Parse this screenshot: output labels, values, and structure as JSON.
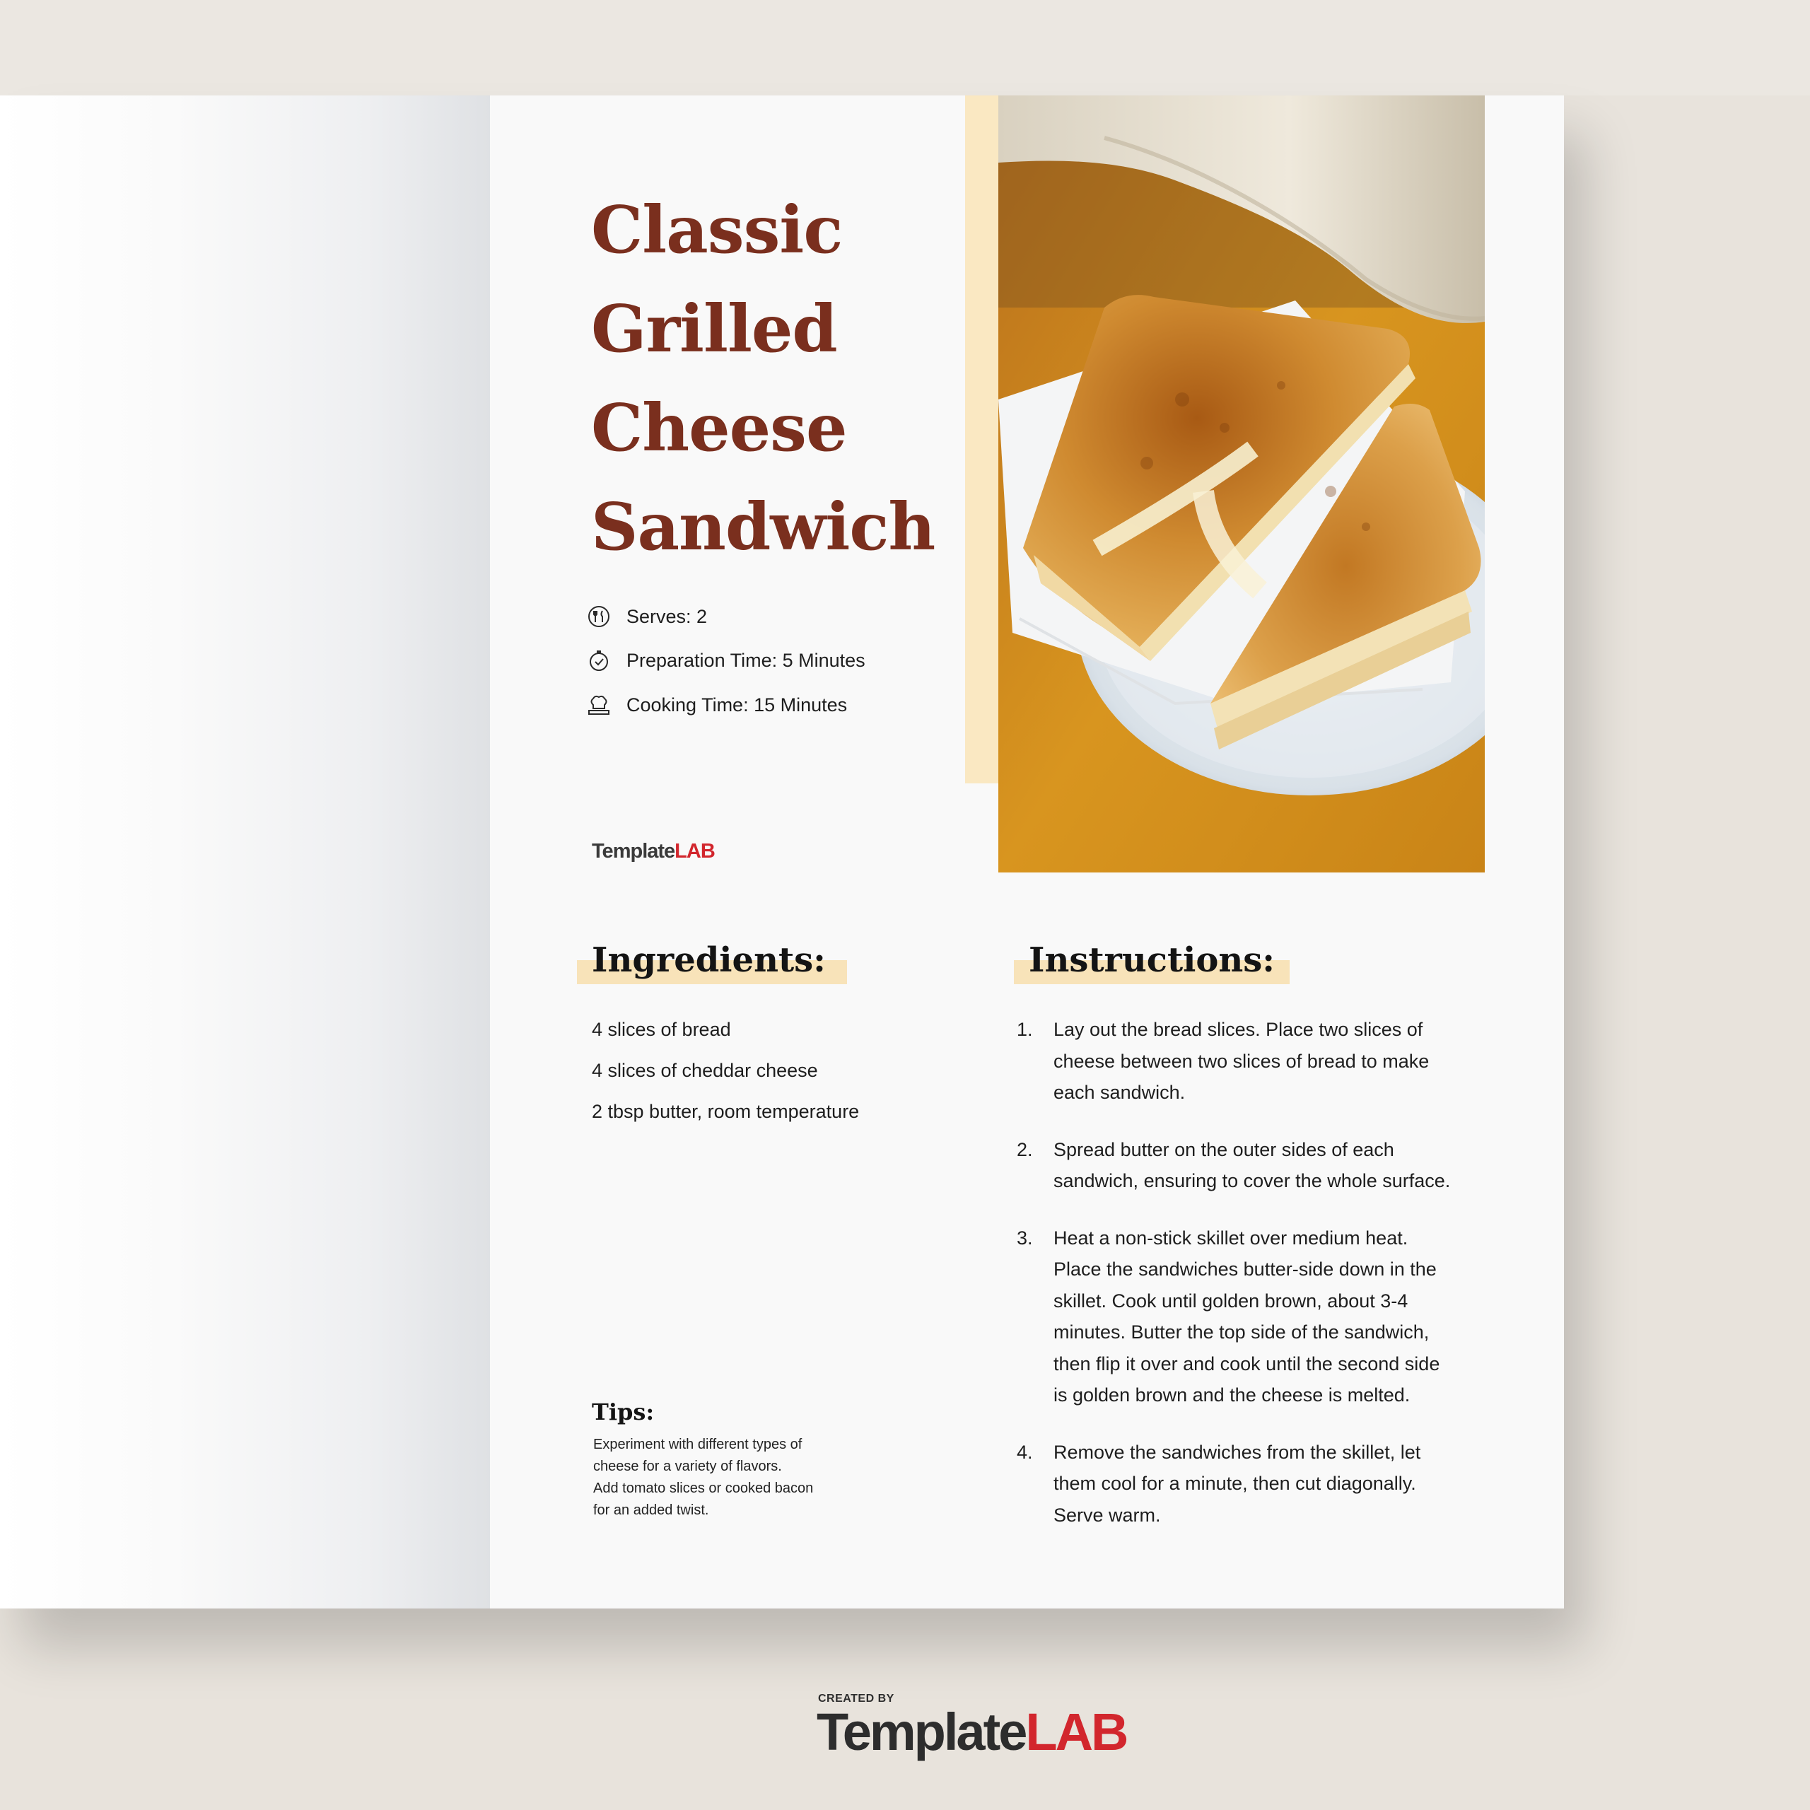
{
  "recipe": {
    "title_lines": [
      "Classic",
      "Grilled",
      "Cheese",
      "Sandwich"
    ],
    "meta": [
      {
        "icon": "utensils-icon",
        "text": "Serves: 2"
      },
      {
        "icon": "stopwatch-icon",
        "text": "Preparation Time: 5 Minutes"
      },
      {
        "icon": "chef-hat-icon",
        "text": "Cooking Time: 15 Minutes"
      }
    ],
    "photo": {
      "subject": "sandwich-photo"
    }
  },
  "brand": {
    "page_logo_part1": "Template",
    "page_logo_part2": "LAB",
    "footer_created_by": "CREATED BY",
    "footer_logo_part1": "Template",
    "footer_logo_part2": "LAB"
  },
  "ingredients": {
    "heading": "Ingredients:",
    "items": [
      "4 slices of bread",
      "4 slices of cheddar cheese",
      "2 tbsp butter, room temperature"
    ]
  },
  "instructions": {
    "heading": "Instructions:",
    "steps": [
      {
        "num": "1.",
        "lines": [
          "Lay out the bread slices. Place two slices of",
          "cheese between two slices of bread to make",
          "each sandwich."
        ]
      },
      {
        "num": "2.",
        "lines": [
          "Spread butter on the outer sides of each",
          "sandwich, ensuring to cover the whole surface."
        ]
      },
      {
        "num": "3.",
        "lines": [
          "Heat a non-stick skillet over medium heat.",
          "Place the sandwiches butter-side down in the",
          "skillet. Cook until golden brown, about 3-4",
          "minutes. Butter the top side of the sandwich,",
          "then flip it over and cook until the second side",
          "is golden brown and the cheese is melted."
        ]
      },
      {
        "num": "4.",
        "lines": [
          "Remove the sandwiches from the skillet, let",
          "them cool for a minute, then cut diagonally.",
          "Serve warm."
        ]
      }
    ]
  },
  "tips": {
    "heading": "Tips:",
    "lines": [
      "Experiment with different types of",
      "cheese for a variety of flavors.",
      "Add tomato slices or cooked bacon",
      "for an added twist."
    ]
  },
  "colors": {
    "title": "#7a2f1e",
    "accent": "#fae8c2",
    "heading_highlight": "#f8e3b9",
    "brand_red": "#d2262d",
    "background": "#e8e3dc"
  }
}
